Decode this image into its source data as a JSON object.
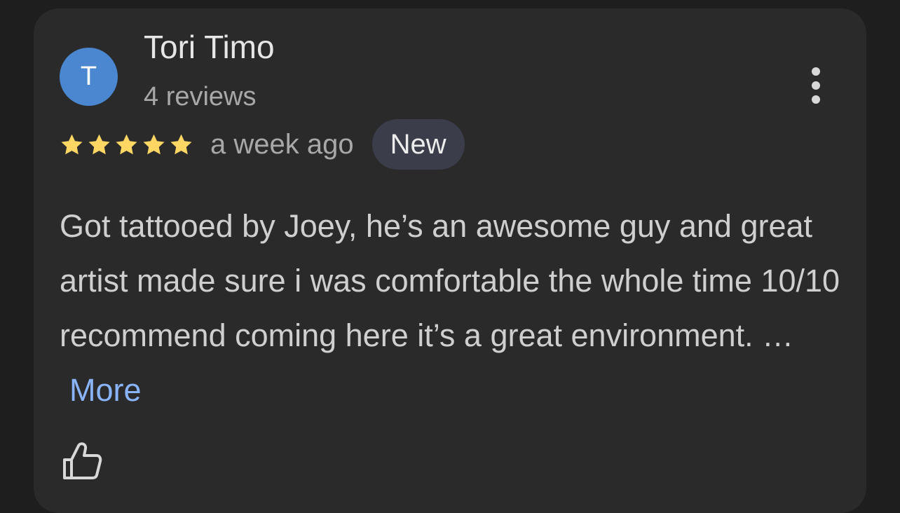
{
  "review": {
    "avatar_initial": "T",
    "reviewer_name": "Tori Timo",
    "reviewer_meta": "4 reviews",
    "rating": 5,
    "rating_max": 5,
    "time_ago": "a week ago",
    "badge": "New",
    "text": "Got tattooed by Joey, he’s an awesome guy and great artist made sure i was comfortable the whole time 10/10 recommend coming here it’s a great environment. …",
    "more_label": "More"
  },
  "icons": {
    "menu": "more-vertical-icon",
    "like": "thumbs-up-icon",
    "star": "star-icon"
  },
  "colors": {
    "background": "#1e1e1e",
    "card": "#2a2a2b",
    "avatar": "#4a87d0",
    "star": "#fdd663",
    "link": "#8ab4f8",
    "badge_bg": "#3b3e4a"
  }
}
